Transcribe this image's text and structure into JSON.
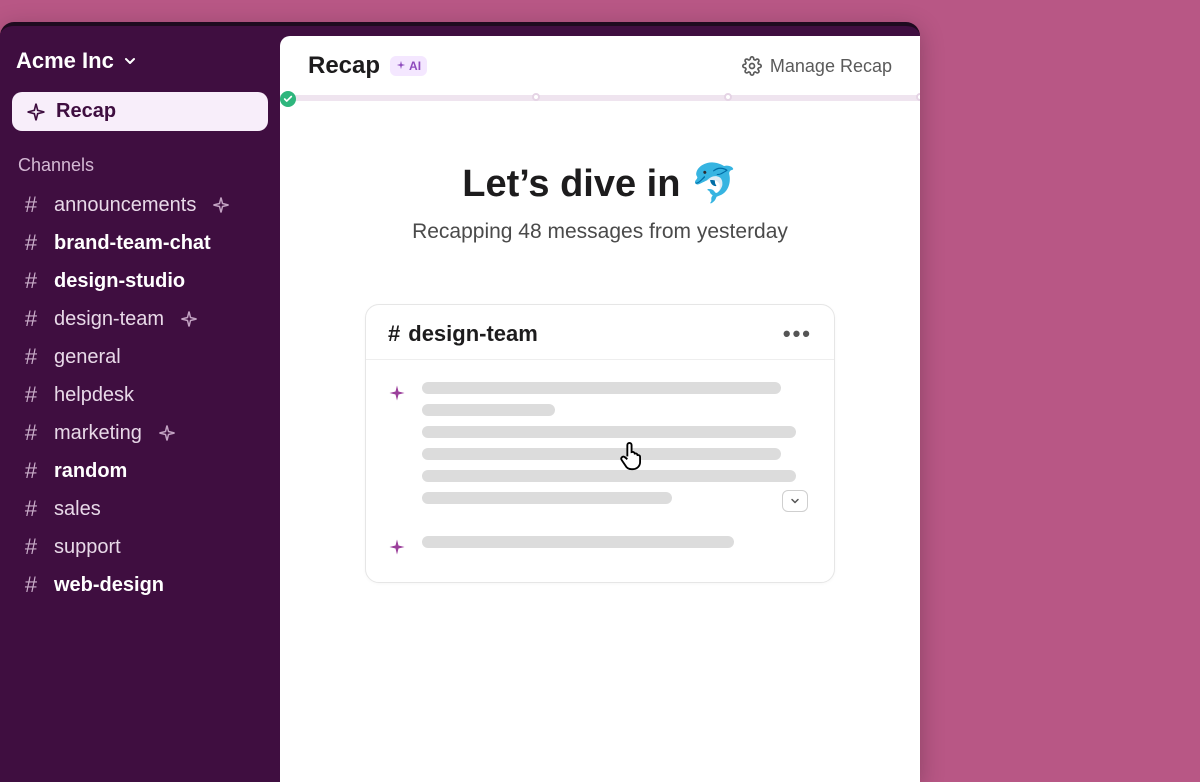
{
  "workspace": {
    "name": "Acme Inc"
  },
  "sidebar": {
    "recap_label": "Recap",
    "channels_label": "Channels",
    "channels": [
      {
        "name": "announcements",
        "bold": false,
        "sparkle": true
      },
      {
        "name": "brand-team-chat",
        "bold": true,
        "sparkle": false
      },
      {
        "name": "design-studio",
        "bold": true,
        "sparkle": false
      },
      {
        "name": "design-team",
        "bold": false,
        "sparkle": true
      },
      {
        "name": "general",
        "bold": false,
        "sparkle": false
      },
      {
        "name": "helpdesk",
        "bold": false,
        "sparkle": false
      },
      {
        "name": "marketing",
        "bold": false,
        "sparkle": true
      },
      {
        "name": "random",
        "bold": true,
        "sparkle": false
      },
      {
        "name": "sales",
        "bold": false,
        "sparkle": false
      },
      {
        "name": "support",
        "bold": false,
        "sparkle": false
      },
      {
        "name": "web-design",
        "bold": true,
        "sparkle": false
      }
    ]
  },
  "header": {
    "title": "Recap",
    "ai_badge": "AI",
    "manage_label": "Manage Recap"
  },
  "progress": {
    "dots": [
      40,
      70,
      100
    ]
  },
  "hero": {
    "title": "Let’s dive in",
    "emoji": "🐬",
    "subtitle": "Recapping 48 messages from yesterday"
  },
  "card": {
    "hash": "#",
    "channel": "design-team",
    "more": "•••"
  },
  "colors": {
    "sidebar_bg": "#3f0e40",
    "page_bg": "#b85785",
    "accent_green": "#2eb67d",
    "ai_purple": "#8e4bbd"
  }
}
